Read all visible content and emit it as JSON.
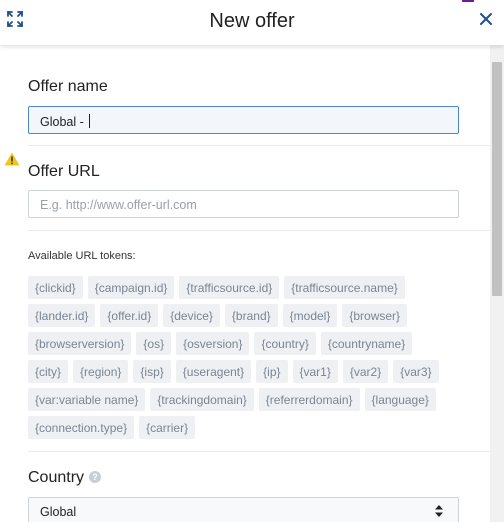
{
  "dialog": {
    "title": "New offer"
  },
  "offer_name": {
    "label": "Offer name",
    "value": "Global - "
  },
  "offer_url": {
    "label": "Offer URL",
    "placeholder": "E.g. http://www.offer-url.com"
  },
  "tokens": {
    "label": "Available URL tokens:",
    "rows": [
      [
        "{clickid}",
        "{campaign.id}",
        "{trafficsource.id}",
        "{trafficsource.name}"
      ],
      [
        "{lander.id}",
        "{offer.id}",
        "{device}",
        "{brand}",
        "{model}",
        "{browser}"
      ],
      [
        "{browserversion}",
        "{os}",
        "{osversion}",
        "{country}",
        "{countryname}"
      ],
      [
        "{city}",
        "{region}",
        "{isp}",
        "{useragent}",
        "{ip}",
        "{var1}",
        "{var2}",
        "{var3}"
      ],
      [
        "{var:variable name}",
        "{trackingdomain}",
        "{referrerdomain}",
        "{language}"
      ],
      [
        "{connection.type}",
        "{carrier}"
      ]
    ]
  },
  "country": {
    "label": "Country",
    "help_icon": "?",
    "selected": "Global"
  },
  "colors": {
    "focus_border": "#4a86c8",
    "warning": "#f0c419",
    "token_bg": "#eef0f3",
    "token_text": "#7a8594",
    "accent": "#6a1b9a"
  },
  "icons": {
    "expand": "expand-icon",
    "close": "close-icon",
    "warning": "warning-icon",
    "help": "help-icon",
    "select_arrows": "sort-arrows-icon"
  }
}
